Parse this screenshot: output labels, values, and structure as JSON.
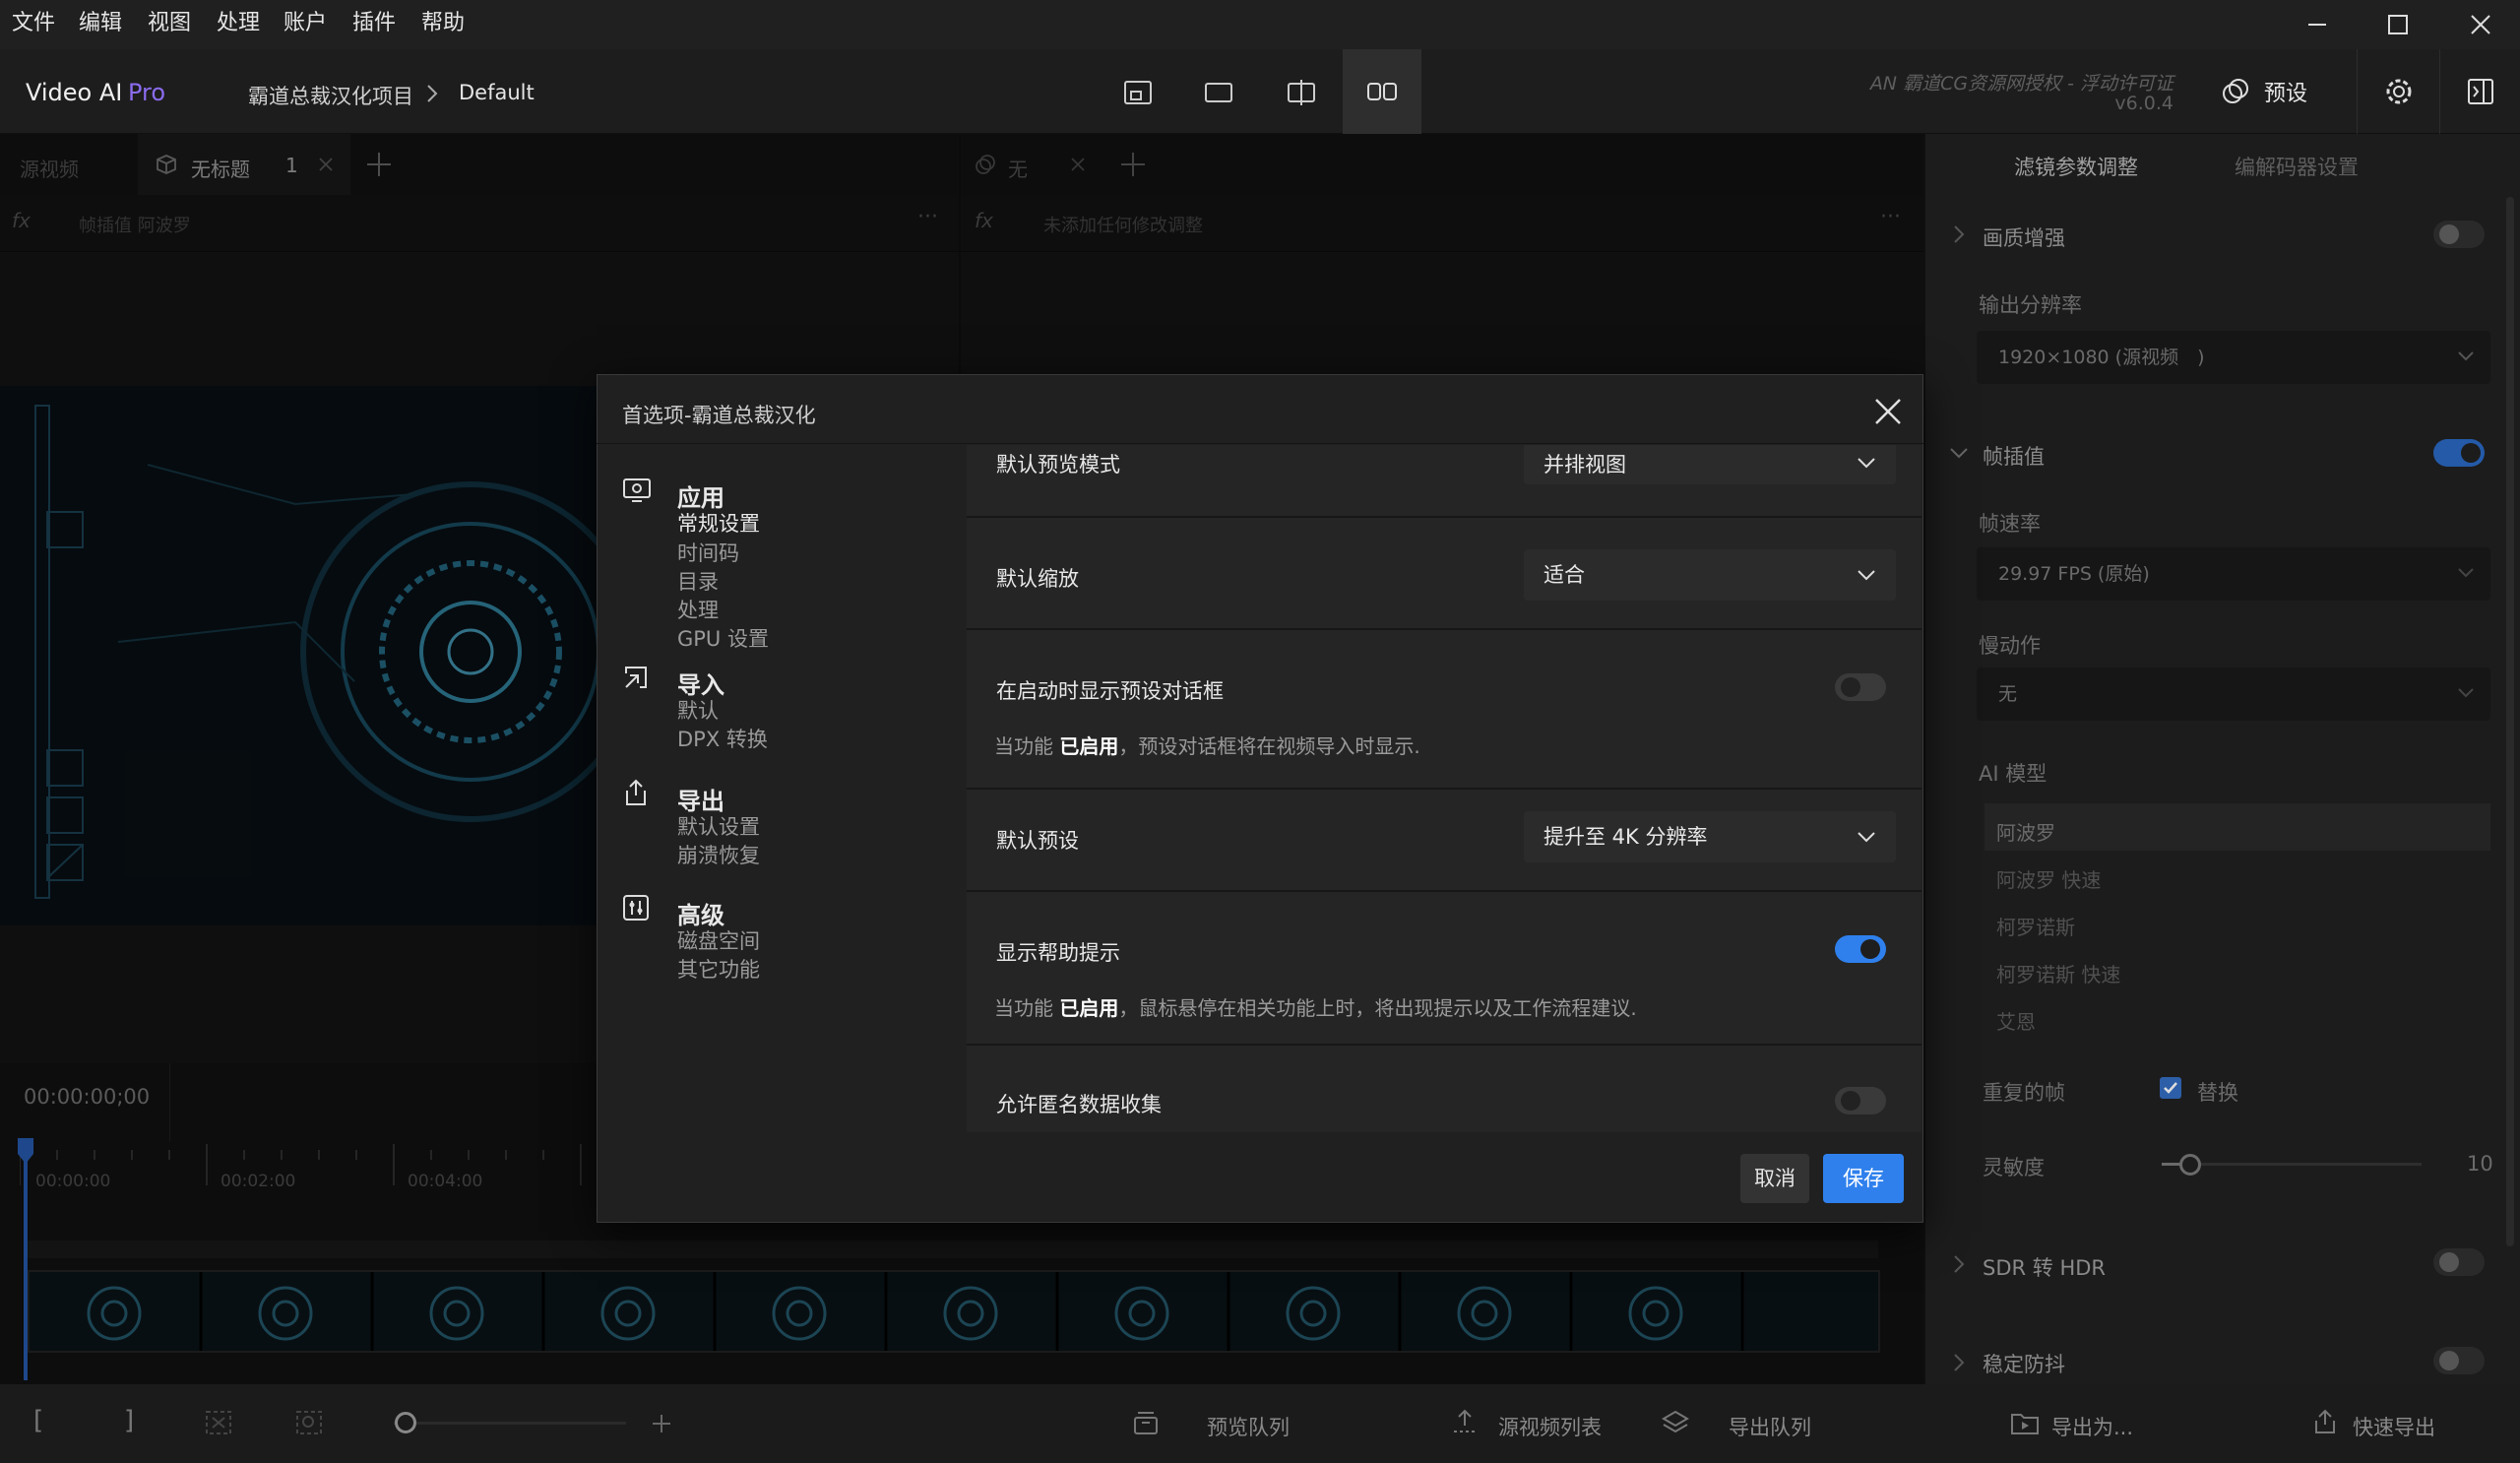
{
  "menubar": {
    "items": [
      "文件",
      "编辑",
      "视图",
      "处理",
      "账户",
      "插件",
      "帮助"
    ]
  },
  "toolbar": {
    "app_name": "Video AI",
    "app_edition": "Pro",
    "breadcrumb_project": "霸道总裁汉化项目",
    "breadcrumb_current": "Default",
    "license_text": "AN 霸道CG资源网授权 - 浮动许可证",
    "version": "v6.0.4",
    "presets_label": "预设"
  },
  "tabs": {
    "source_tab": "源视频",
    "untitled_tab": "无标题",
    "untitled_count": "1",
    "right_tab": "无"
  },
  "fxbar": {
    "left_text": "帧插值 阿波罗",
    "right_text": "未添加任何修改调整"
  },
  "timeline": {
    "timecode": "00:00:00;00",
    "ticks": [
      "00:00:00",
      "00:02:00",
      "00:04:00"
    ]
  },
  "right_panel": {
    "tab_filters": "滤镜参数调整",
    "tab_encoder": "编解码器设置",
    "enhance_label": "画质增强",
    "output_res_label": "输出分辨率",
    "output_res_value": "1920×1080 (源视频　)",
    "frame_interp_label": "帧插值",
    "fps_label": "帧速率",
    "fps_value": "29.97 FPS (原始)",
    "slowmo_label": "慢动作",
    "slowmo_value": "无",
    "ai_model_label": "AI 模型",
    "ai_models": [
      "阿波罗",
      "阿波罗 快速",
      "柯罗诺斯",
      "柯罗诺斯 快速",
      "艾恩"
    ],
    "dup_frames_label": "重复的帧",
    "replace_label": "替换",
    "sensitivity_label": "灵敏度",
    "sensitivity_value": "10",
    "sdr_hdr_label": "SDR 转 HDR",
    "stabilize_label": "稳定防抖"
  },
  "bottombar": {
    "preview_queue": "预览队列",
    "source_list": "源视频列表",
    "export_queue": "导出队列",
    "export_as": "导出为...",
    "quick_export": "快速导出"
  },
  "dialog": {
    "title": "首选项-霸道总裁汉化",
    "nav": [
      {
        "head": "应用",
        "subs": [
          "常规设置",
          "时间码",
          "目录",
          "处理",
          "GPU 设置"
        ]
      },
      {
        "head": "导入",
        "subs": [
          "默认",
          "DPX 转换"
        ]
      },
      {
        "head": "导出",
        "subs": [
          "默认设置",
          "崩溃恢复"
        ]
      },
      {
        "head": "高级",
        "subs": [
          "磁盘空间",
          "其它功能"
        ]
      }
    ],
    "settings": {
      "preview_mode_label": "默认预览模式",
      "preview_mode_value": "并排视图",
      "zoom_label": "默认缩放",
      "zoom_value": "适合",
      "show_presets_label": "在启动时显示预设对话框",
      "show_presets_desc_pre": "当功能 ",
      "show_presets_desc_bold": "已启用",
      "show_presets_desc_post": "，预设对话框将在视频导入时显示.",
      "default_preset_label": "默认预设",
      "default_preset_value": "提升至 4K 分辨率",
      "help_tips_label": "显示帮助提示",
      "help_tips_desc_pre": "当功能 ",
      "help_tips_desc_bold": "已启用",
      "help_tips_desc_post": "，鼠标悬停在相关功能上时，将出现提示以及工作流程建议.",
      "anon_data_label": "允许匿名数据收集"
    },
    "cancel": "取消",
    "save": "保存"
  },
  "colors": {
    "accent": "#2f80ed",
    "pro": "#8b6cf0"
  }
}
